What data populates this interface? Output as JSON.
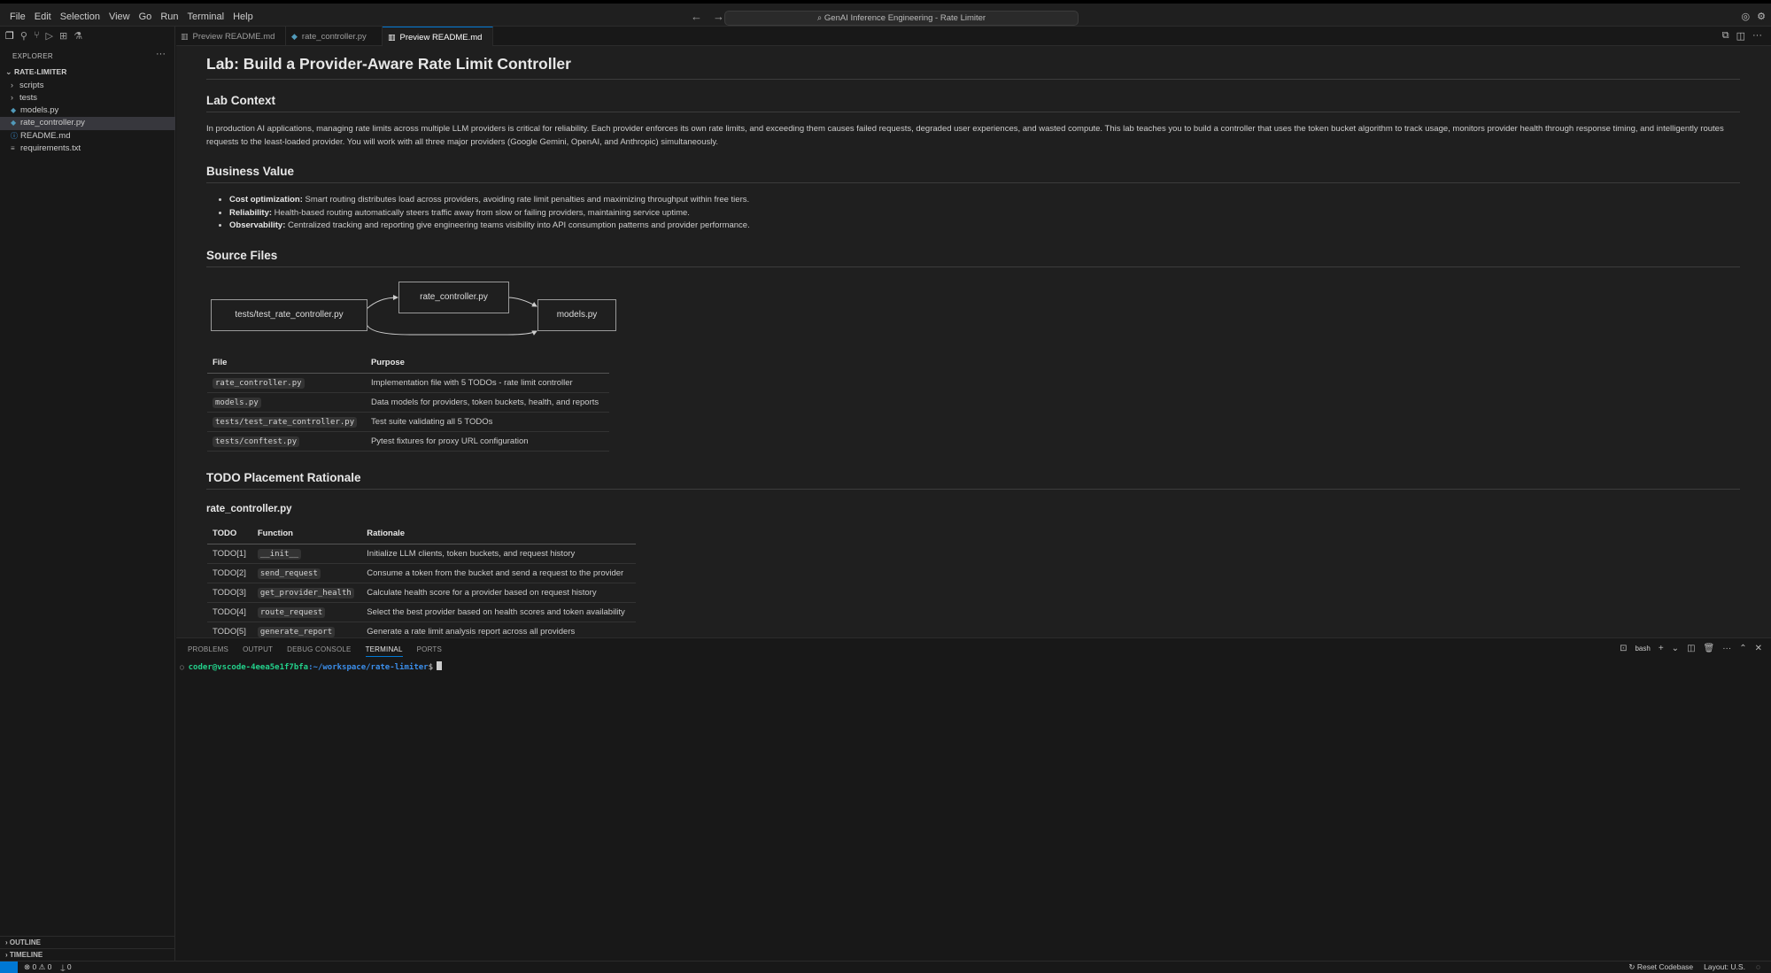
{
  "menu": [
    "File",
    "Edit",
    "Selection",
    "View",
    "Go",
    "Run",
    "Terminal",
    "Help"
  ],
  "command_center": "GenAI Inference Engineering - Rate Limiter",
  "explorer": {
    "title": "EXPLORER",
    "root": "RATE-LIMITER",
    "items": [
      {
        "label": "scripts"
      },
      {
        "label": "tests"
      },
      {
        "label": "models.py"
      },
      {
        "label": "rate_controller.py"
      },
      {
        "label": "README.md"
      },
      {
        "label": "requirements.txt"
      }
    ],
    "outline": "OUTLINE",
    "timeline": "TIMELINE"
  },
  "tabs": [
    {
      "label": "Preview README.md"
    },
    {
      "label": "rate_controller.py"
    },
    {
      "label": "Preview README.md"
    }
  ],
  "doc": {
    "title": "Lab: Build a Provider-Aware Rate Limit Controller",
    "context_heading": "Lab Context",
    "context_text": "In production AI applications, managing rate limits across multiple LLM providers is critical for reliability. Each provider enforces its own rate limits, and exceeding them causes failed requests, degraded user experiences, and wasted compute. This lab teaches you to build a controller that uses the token bucket algorithm to track usage, monitors provider health through response timing, and intelligently routes requests to the least-loaded provider. You will work with all three major providers (Google Gemini, OpenAI, and Anthropic) simultaneously.",
    "value_heading": "Business Value",
    "value_items": [
      {
        "bold": "Cost optimization:",
        "text": " Smart routing distributes load across providers, avoiding rate limit penalties and maximizing throughput within free tiers."
      },
      {
        "bold": "Reliability:",
        "text": " Health-based routing automatically steers traffic away from slow or failing providers, maintaining service uptime."
      },
      {
        "bold": "Observability:",
        "text": " Centralized tracking and reporting give engineering teams visibility into API consumption patterns and provider performance."
      }
    ],
    "source_heading": "Source Files",
    "diagram": {
      "nodes": [
        "tests/test_rate_controller.py",
        "rate_controller.py",
        "models.py"
      ]
    },
    "files_table": {
      "headers": [
        "File",
        "Purpose"
      ],
      "rows": [
        {
          "file": "rate_controller.py",
          "purpose": "Implementation file with 5 TODOs - rate limit controller"
        },
        {
          "file": "models.py",
          "purpose": "Data models for providers, token buckets, health, and reports"
        },
        {
          "file": "tests/test_rate_controller.py",
          "purpose": "Test suite validating all 5 TODOs"
        },
        {
          "file": "tests/conftest.py",
          "purpose": "Pytest fixtures for proxy URL configuration"
        }
      ]
    },
    "todo_heading": "TODO Placement Rationale",
    "todo_subheading": "rate_controller.py",
    "todo_table": {
      "headers": [
        "TODO",
        "Function",
        "Rationale"
      ],
      "rows": [
        {
          "todo": "TODO[1]",
          "fn": "__init__",
          "why": "Initialize LLM clients, token buckets, and request history"
        },
        {
          "todo": "TODO[2]",
          "fn": "send_request",
          "why": "Consume a token from the bucket and send a request to the provider"
        },
        {
          "todo": "TODO[3]",
          "fn": "get_provider_health",
          "why": "Calculate health score for a provider based on request history"
        },
        {
          "todo": "TODO[4]",
          "fn": "route_request",
          "why": "Select the best provider based on health scores and token availability"
        },
        {
          "todo": "TODO[5]",
          "fn": "generate_report",
          "why": "Generate a rate limit analysis report across all providers"
        }
      ]
    }
  },
  "panel": {
    "tabs": [
      "PROBLEMS",
      "OUTPUT",
      "DEBUG CONSOLE",
      "TERMINAL",
      "PORTS"
    ],
    "shell": "bash",
    "prompt_user": "coder@vscode-4eea5e1f7bfa",
    "prompt_path": ":~/workspace/rate-limiter",
    "prompt_symbol": "$"
  },
  "status": {
    "errors": "0",
    "warnings": "0",
    "ports": "0",
    "reset": "Reset Codebase",
    "layout": "Layout: U.S."
  },
  "colors": {
    "accent": "#0078d4",
    "background": "#1f1f1f"
  }
}
